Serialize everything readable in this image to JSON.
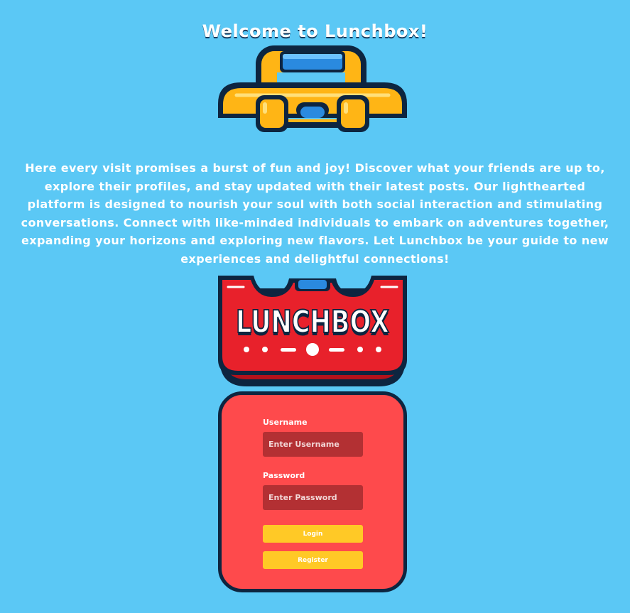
{
  "header": {
    "title": "Welcome to Lunchbox!"
  },
  "intro": {
    "text": "Here every visit promises a burst of fun and joy! Discover what your friends are up to, explore their profiles, and stay updated with their latest posts. Our lighthearted platform is designed to nourish your soul with both social interaction and stimulating conversations. Connect with like-minded individuals to embark on adventures together, expanding your horizons and exploring new flavors. Let Lunchbox be your guide to new experiences and delightful connections!"
  },
  "brand": {
    "logo_text": "LUNCHBOX",
    "top_icon": "lunchbox-handle-icon"
  },
  "login": {
    "username_label": "Username",
    "username_placeholder": "Enter Username",
    "username_value": "",
    "password_label": "Password",
    "password_placeholder": "Enter Password",
    "password_value": "",
    "login_label": "Login",
    "register_label": "Register"
  },
  "colors": {
    "background": "#5bc8f5",
    "card": "#fe4a4c",
    "card_border": "#0d2540",
    "input": "#b33033",
    "button": "#ffc926",
    "logo_red": "#e8212b",
    "logo_yellow": "#ffb515",
    "logo_blue": "#2a8adf"
  }
}
